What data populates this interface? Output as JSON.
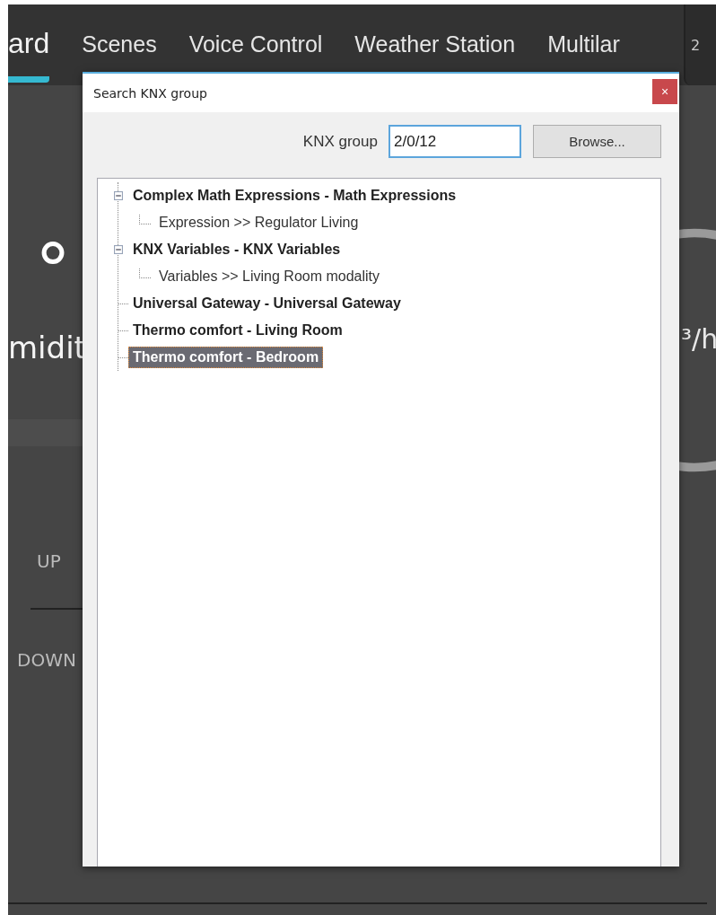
{
  "tabs": [
    {
      "label": "ard",
      "selected": true
    },
    {
      "label": "Scenes",
      "selected": false
    },
    {
      "label": "Voice Control",
      "selected": false
    },
    {
      "label": "Weather Station",
      "selected": false
    },
    {
      "label": "Multilar",
      "selected": false
    }
  ],
  "corner_label": "2",
  "background": {
    "temperature": "°",
    "humidity_label": "midit",
    "flow_unit": "³/h",
    "up_label": "UP",
    "down_label": "DOWN"
  },
  "dialog": {
    "title": "Search KNX group",
    "close": "×",
    "field_label": "KNX group",
    "field_value": "2/0/12",
    "browse_button": "Browse...",
    "tree": [
      {
        "label": "Complex Math Expressions - Math Expressions",
        "expanded": true,
        "selected": false,
        "children": [
          {
            "label": "Expression >> Regulator Living",
            "selected": false
          }
        ]
      },
      {
        "label": "KNX Variables - KNX Variables",
        "expanded": true,
        "selected": false,
        "children": [
          {
            "label": "Variables >> Living Room modality",
            "selected": false
          }
        ]
      },
      {
        "label": "Universal Gateway - Universal Gateway",
        "selected": false
      },
      {
        "label": "Thermo comfort - Living Room",
        "selected": false
      },
      {
        "label": "Thermo comfort - Bedroom",
        "selected": true
      }
    ]
  }
}
